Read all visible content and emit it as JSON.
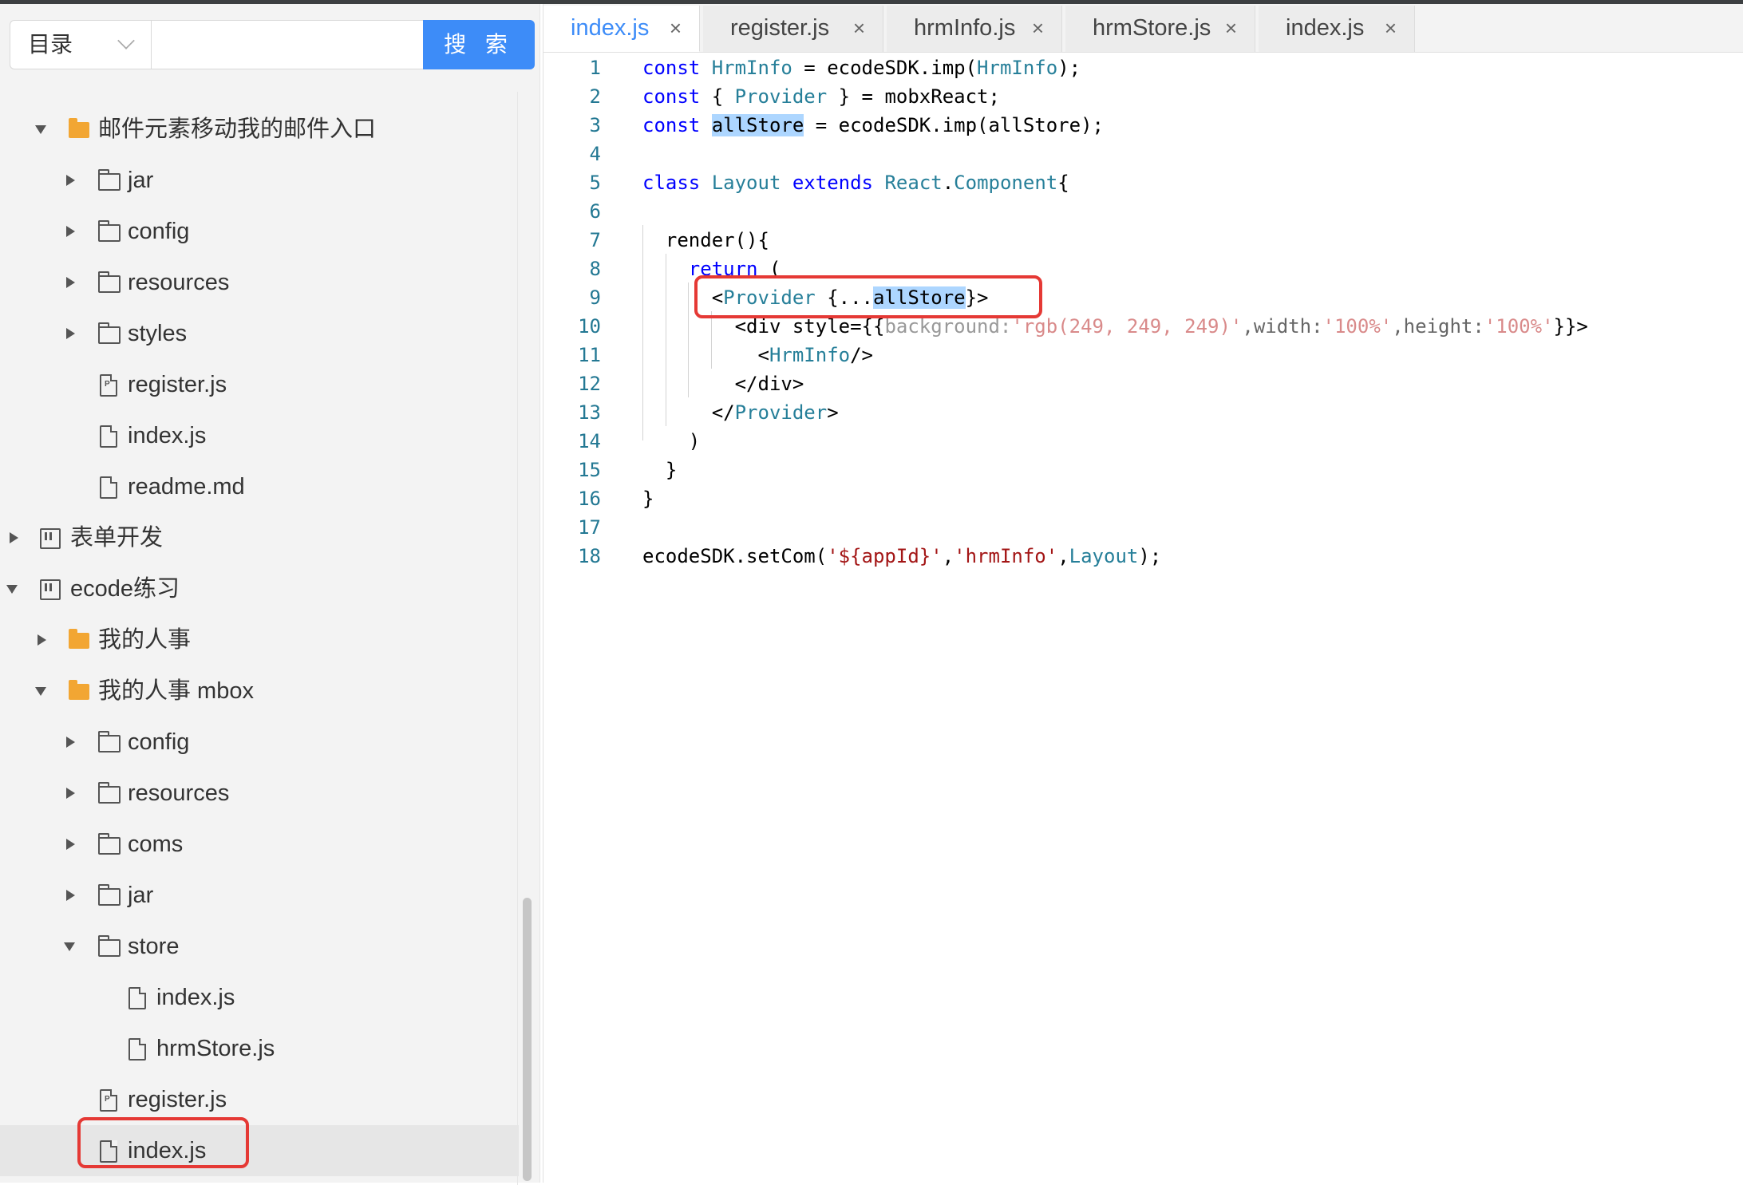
{
  "sidebar": {
    "search": {
      "select_label": "目录",
      "button_label": "搜 索",
      "input_value": "",
      "placeholder": ""
    },
    "tree": [
      {
        "label": "邮件元素移动我的邮件入口",
        "type": "folder",
        "expanded": true
      },
      {
        "label": "jar",
        "type": "folder-outline",
        "expanded": false
      },
      {
        "label": "config",
        "type": "folder-outline",
        "expanded": false
      },
      {
        "label": "resources",
        "type": "folder-outline",
        "expanded": false
      },
      {
        "label": "styles",
        "type": "folder-outline",
        "expanded": false
      },
      {
        "label": "register.js",
        "type": "file-p"
      },
      {
        "label": "index.js",
        "type": "file"
      },
      {
        "label": "readme.md",
        "type": "file"
      },
      {
        "label": "表单开发",
        "type": "board",
        "expanded": false
      },
      {
        "label": "ecode练习",
        "type": "board",
        "expanded": true
      },
      {
        "label": "我的人事",
        "type": "folder",
        "expanded": false
      },
      {
        "label": "我的人事 mbox",
        "type": "folder",
        "expanded": true
      },
      {
        "label": "config",
        "type": "folder-outline",
        "expanded": false
      },
      {
        "label": "resources",
        "type": "folder-outline",
        "expanded": false
      },
      {
        "label": "coms",
        "type": "folder-outline",
        "expanded": false
      },
      {
        "label": "jar",
        "type": "folder-outline",
        "expanded": false
      },
      {
        "label": "store",
        "type": "folder-outline",
        "expanded": true
      },
      {
        "label": "index.js",
        "type": "file"
      },
      {
        "label": "hrmStore.js",
        "type": "file"
      },
      {
        "label": "register.js",
        "type": "file-p"
      },
      {
        "label": "index.js",
        "type": "file",
        "selected": true
      }
    ]
  },
  "editor": {
    "tabs": [
      {
        "label": "index.js",
        "active": true
      },
      {
        "label": "register.js"
      },
      {
        "label": "hrmInfo.js"
      },
      {
        "label": "hrmStore.js"
      },
      {
        "label": "index.js"
      }
    ],
    "close_glyph": "×",
    "line_numbers": [
      "1",
      "2",
      "3",
      "4",
      "5",
      "6",
      "7",
      "8",
      "9",
      "10",
      "11",
      "12",
      "13",
      "14",
      "15",
      "16",
      "17",
      "18"
    ],
    "code_lines": [
      "const HrmInfo = ecodeSDK.imp(HrmInfo);",
      "const { Provider } = mobxReact;",
      "const allStore = ecodeSDK.imp(allStore);",
      "",
      "class Layout extends React.Component{",
      "",
      "  render(){",
      "    return (",
      "      <Provider {...allStore}>",
      "        <div style={{background:'rgb(249, 249, 249)',width:'100%',height:'100%'}}>",
      "          <HrmInfo/>",
      "        </div>",
      "      </Provider>",
      "    )",
      "  }",
      "}",
      "",
      "ecodeSDK.setCom('${appId}','hrmInfo',Layout);"
    ]
  },
  "colors": {
    "accent": "#3d8cf8",
    "highlight_box": "#e53935",
    "folder": "#f2a633"
  }
}
